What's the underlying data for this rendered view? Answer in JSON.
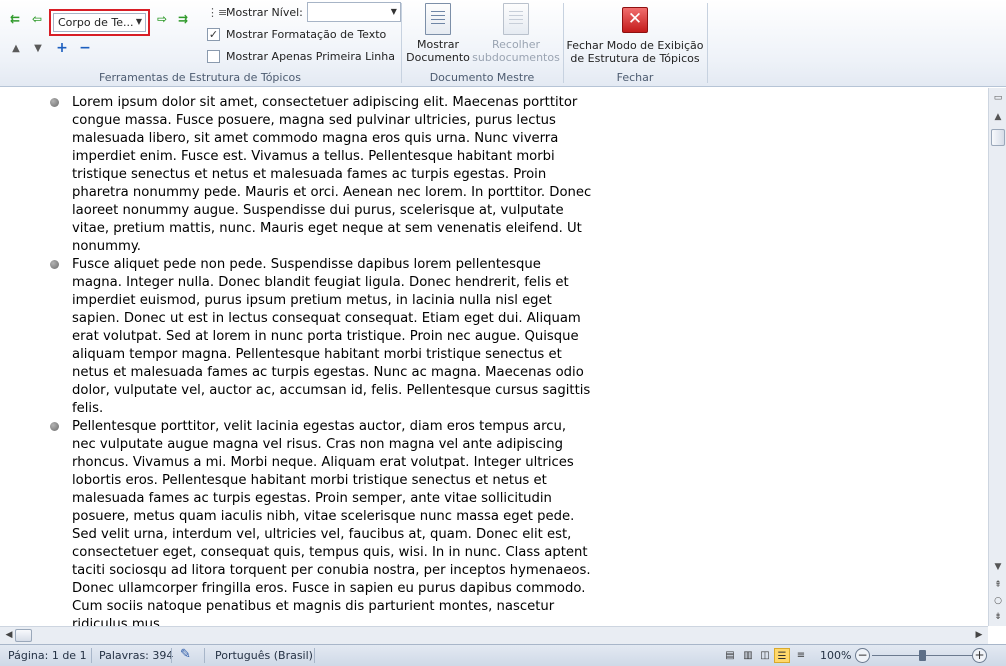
{
  "ribbon": {
    "outline_tools": {
      "label": "Ferramentas de Estrutura de Tópicos",
      "level_value": "Corpo de Te...",
      "show_level_label": "Mostrar Nível:",
      "show_level_value": "",
      "show_formatting_label": "Mostrar Formatação de Texto",
      "show_formatting_checked": true,
      "show_first_line_label": "Mostrar Apenas Primeira Linha",
      "show_first_line_checked": false
    },
    "master_document": {
      "label": "Documento Mestre",
      "show_doc_line1": "Mostrar",
      "show_doc_line2": "Documento",
      "collapse_line1": "Recolher",
      "collapse_line2": "subdocumentos"
    },
    "close": {
      "label": "Fechar",
      "close_line1": "Fechar Modo de Exibição",
      "close_line2": "de Estrutura de Tópicos"
    }
  },
  "document": {
    "paragraphs": [
      "Lorem ipsum dolor sit amet, consectetuer adipiscing elit. Maecenas porttitor congue massa. Fusce posuere, magna sed pulvinar ultricies, purus lectus malesuada libero, sit amet commodo magna eros quis urna. Nunc viverra imperdiet enim. Fusce est. Vivamus a tellus. Pellentesque habitant morbi tristique senectus et netus et malesuada fames ac turpis egestas. Proin pharetra nonummy pede. Mauris et orci. Aenean nec lorem. In porttitor. Donec laoreet nonummy augue. Suspendisse dui purus, scelerisque at, vulputate vitae, pretium mattis, nunc. Mauris eget neque at sem venenatis eleifend. Ut nonummy.",
      "Fusce aliquet pede non pede. Suspendisse dapibus lorem pellentesque magna. Integer nulla. Donec blandit feugiat ligula. Donec hendrerit, felis et imperdiet euismod, purus ipsum pretium metus, in lacinia nulla nisl eget sapien. Donec ut est in lectus consequat consequat. Etiam eget dui. Aliquam erat volutpat. Sed at lorem in nunc porta tristique. Proin nec augue. Quisque aliquam tempor magna. Pellentesque habitant morbi tristique senectus et netus et malesuada fames ac turpis egestas. Nunc ac magna. Maecenas odio dolor, vulputate vel, auctor ac, accumsan id, felis. Pellentesque cursus sagittis felis.",
      "Pellentesque porttitor, velit lacinia egestas auctor, diam eros tempus arcu, nec vulputate augue magna vel risus. Cras non magna vel ante adipiscing rhoncus. Vivamus a mi. Morbi neque. Aliquam erat volutpat. Integer ultrices lobortis eros. Pellentesque habitant morbi tristique senectus et netus et malesuada fames ac turpis egestas. Proin semper, ante vitae sollicitudin posuere, metus quam iaculis nibh, vitae scelerisque nunc massa eget pede. Sed velit urna, interdum vel, ultricies vel, faucibus at, quam. Donec elit est, consectetuer eget, consequat quis, tempus quis, wisi. In in nunc. Class aptent taciti sociosqu ad litora torquent per conubia nostra, per inceptos hymenaeos. Donec ullamcorper fringilla eros. Fusce in sapien eu purus dapibus commodo. Cum sociis natoque penatibus et magnis dis parturient montes, nascetur ridiculus mus."
    ]
  },
  "status_bar": {
    "page": "Página: 1 de 1",
    "words": "Palavras: 394",
    "language": "Português (Brasil)",
    "zoom": "100%"
  },
  "colors": {
    "highlight_box": "#d81e26",
    "ribbon_bg": "#eef2f8",
    "status_bg": "#d6dfeb"
  }
}
